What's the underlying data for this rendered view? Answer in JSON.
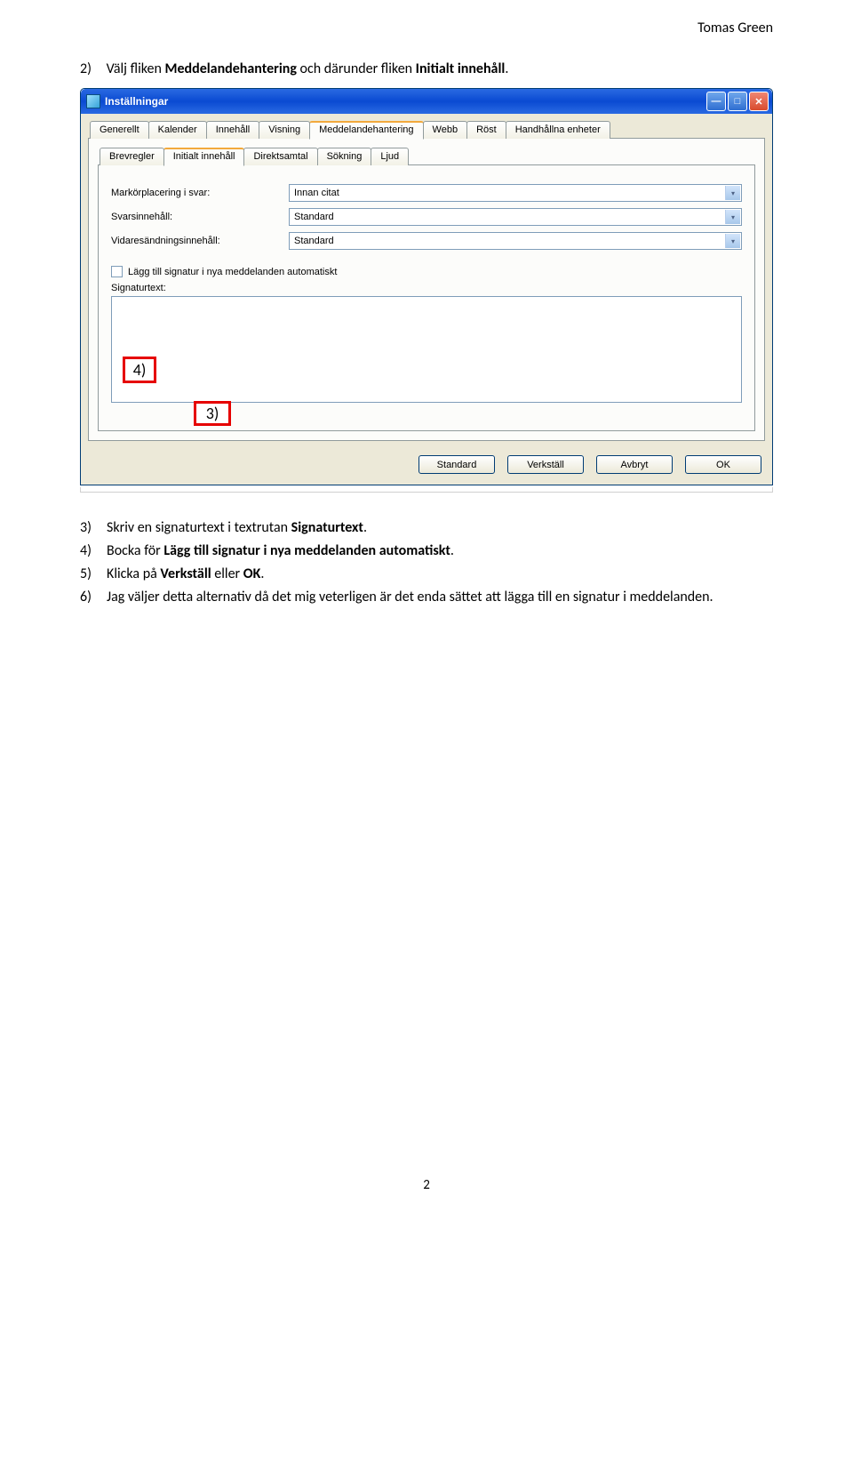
{
  "header_name": "Tomas Green",
  "top_instruction": {
    "num": "2)",
    "pre": "Välj fliken ",
    "bold1": "Meddelandehantering",
    "mid": " och därunder fliken ",
    "bold2": "Initialt innehåll",
    "post": "."
  },
  "dialog": {
    "title": "Inställningar",
    "tabs_top": [
      "Generellt",
      "Kalender",
      "Innehåll",
      "Visning",
      "Meddelandehantering",
      "Webb",
      "Röst",
      "Handhållna enheter"
    ],
    "tabs_top_active": 4,
    "tabs_sub": [
      "Brevregler",
      "Initialt innehåll",
      "Direktsamtal",
      "Sökning",
      "Ljud"
    ],
    "tabs_sub_active": 1,
    "rows": [
      {
        "label": "Markörplacering i svar:",
        "value": "Innan citat"
      },
      {
        "label": "Svarsinnehåll:",
        "value": "Standard"
      },
      {
        "label": "Vidaresändningsinnehåll:",
        "value": "Standard"
      }
    ],
    "checkbox_label": "Lägg till signatur i nya meddelanden automatiskt",
    "signature_label": "Signaturtext:",
    "buttons": [
      "Standard",
      "Verkställ",
      "Avbryt",
      "OK"
    ]
  },
  "marker4": "4)",
  "marker3": "3)",
  "steps": [
    {
      "n": "3)",
      "pre": "Skriv en signaturtext i textrutan ",
      "bold": "Signaturtext",
      "post": "."
    },
    {
      "n": "4)",
      "pre": "Bocka för ",
      "bold": "Lägg till signatur i nya meddelanden automatiskt",
      "post": "."
    },
    {
      "n": "5)",
      "pre": "Klicka på ",
      "bold": "Verkställ",
      "mid": " eller ",
      "bold2": "OK",
      "post": "."
    },
    {
      "n": "6)",
      "pre": "Jag väljer detta alternativ då det mig veterligen är det enda sättet att lägga till en signatur i meddelanden.",
      "bold": "",
      "post": ""
    }
  ],
  "page_number": "2"
}
